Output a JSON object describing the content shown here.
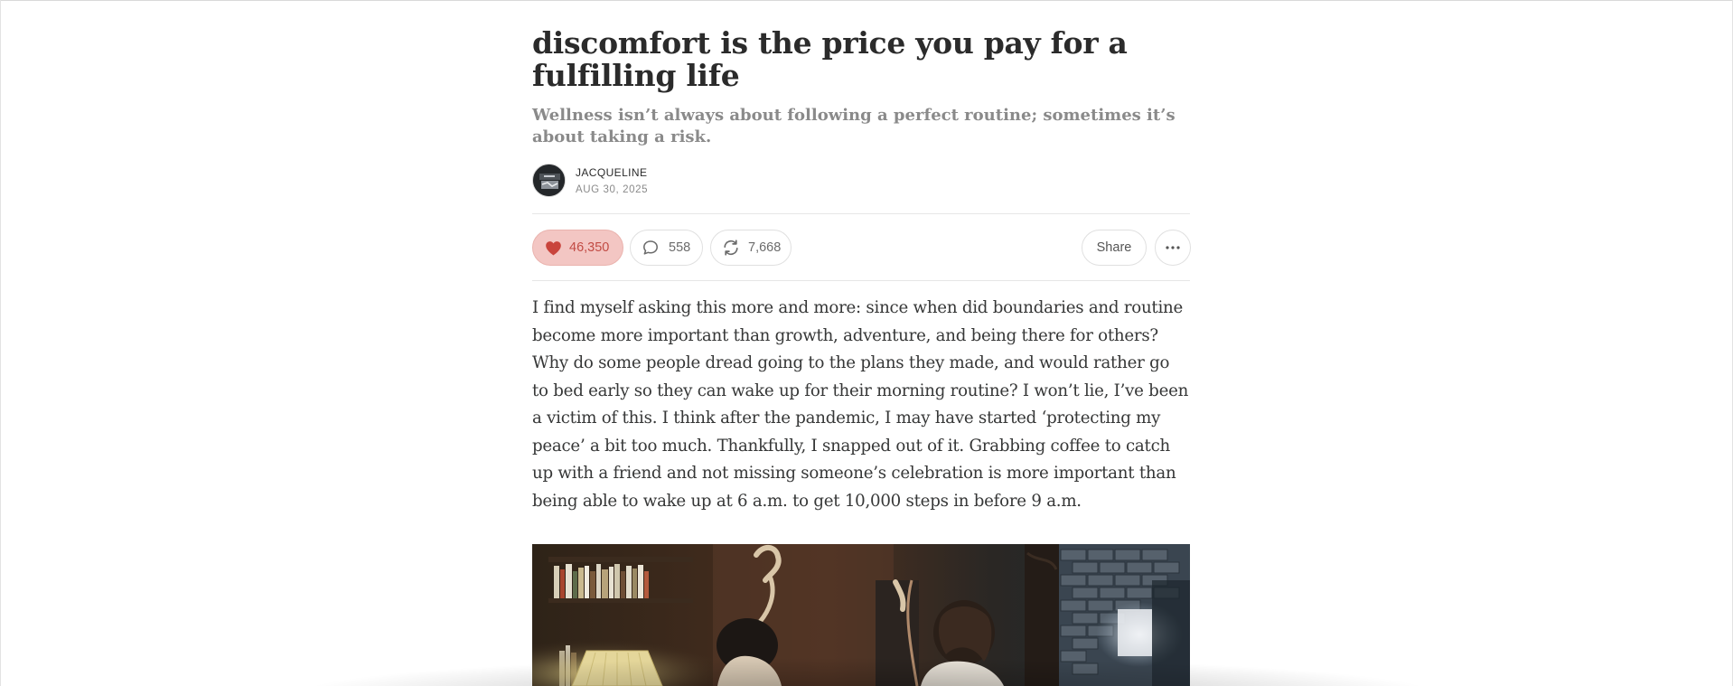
{
  "post": {
    "title": "discomfort is the price you pay for a fulfilling life",
    "subtitle": "Wellness isn’t always about following a perfect routine; sometimes it’s about taking a risk.",
    "author": "JACQUELINE",
    "date": "AUG 30, 2025",
    "body": "I find myself asking this more and more: since when did boundaries and routine become more important than growth, adventure, and being there for others? Why do some people dread going to the plans they made, and would rather go to bed early so they can wake up for their morning routine? I won’t lie, I’ve been a victim of this. I think after the pandemic, I may have started ‘protecting my peace’ a bit too much. Thankfully, I snapped out of it. Grabbing coffee to catch up with a friend and not missing someone’s celebration is more important than being able to wake up at 6 a.m. to get 10,000 steps in before 9 a.m."
  },
  "actions": {
    "likes": "46,350",
    "comments": "558",
    "restacks": "7,668",
    "share_label": "Share"
  },
  "icons": {
    "like": "heart-icon",
    "comment": "comment-bubble-icon",
    "restack": "restack-icon",
    "more": "ellipsis-icon"
  },
  "colors": {
    "like_bg": "#f3c6c3",
    "like_fg": "#c24b44",
    "title": "#2b2b2b",
    "subtitle": "#8a8a8a",
    "body": "#363737"
  }
}
